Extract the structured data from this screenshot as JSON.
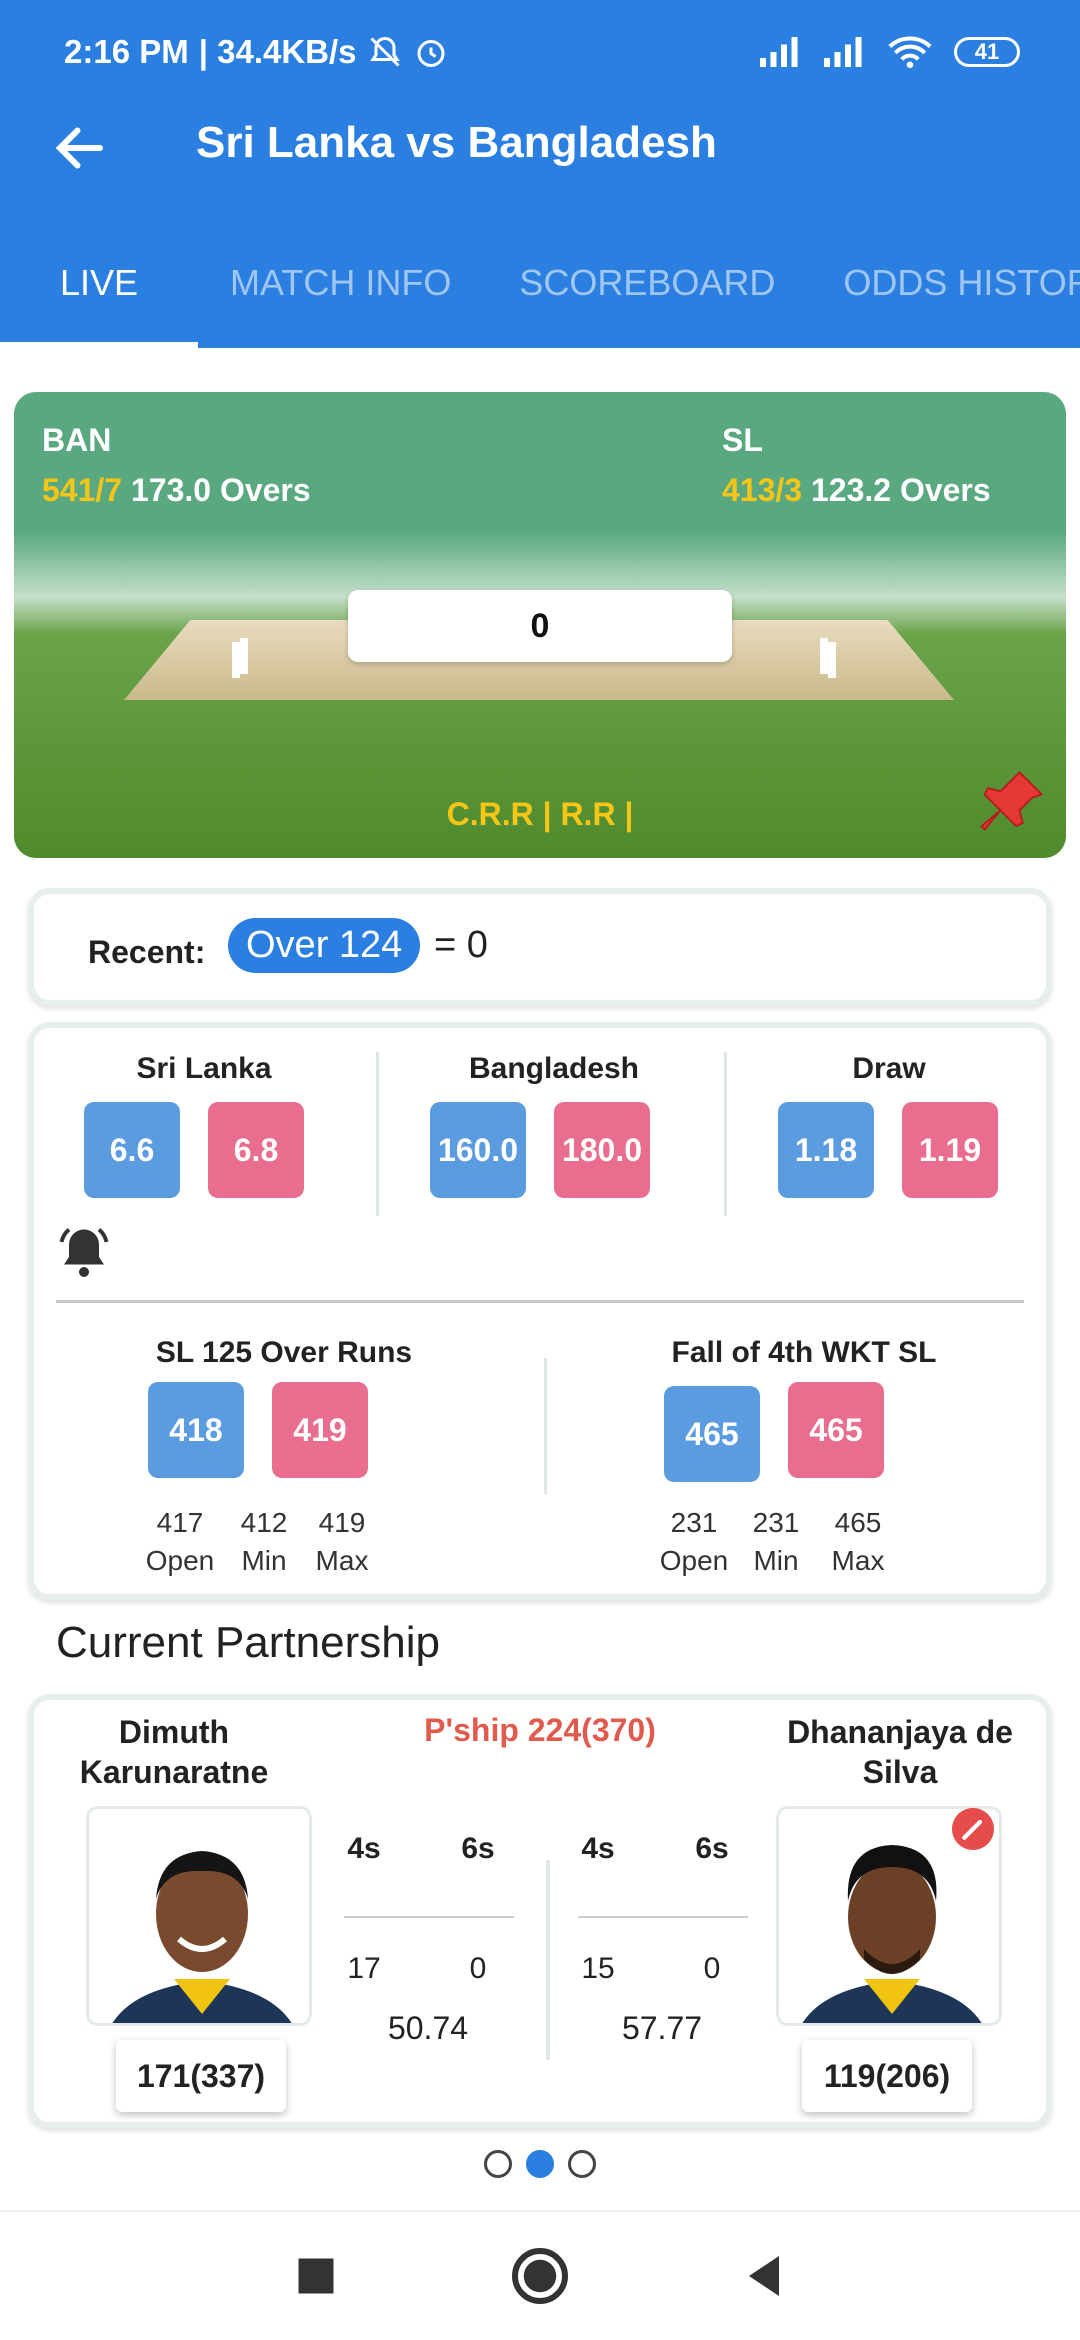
{
  "status_bar": {
    "time": "2:16 PM",
    "speed": "| 34.4KB/s",
    "battery": "41"
  },
  "header": {
    "title": "Sri Lanka vs Bangladesh"
  },
  "tabs": [
    {
      "label": "LIVE"
    },
    {
      "label": "MATCH INFO"
    },
    {
      "label": "SCOREBOARD"
    },
    {
      "label": "ODDS HISTORY"
    }
  ],
  "scorecard": {
    "team1": {
      "name": "BAN",
      "runs": "541/7",
      "overs": "173.0 Overs"
    },
    "team2": {
      "name": "SL",
      "runs": "413/3",
      "overs": "123.2 Overs"
    },
    "ball_value": "0",
    "rates": "C.R.R | R.R |"
  },
  "recent": {
    "label": "Recent:",
    "over": "Over 124",
    "result": "= 0"
  },
  "odds": {
    "match": [
      {
        "name": "Sri Lanka",
        "back": "6.6",
        "lay": "6.8"
      },
      {
        "name": "Bangladesh",
        "back": "160.0",
        "lay": "180.0"
      },
      {
        "name": "Draw",
        "back": "1.18",
        "lay": "1.19"
      }
    ],
    "sessions": [
      {
        "name": "SL 125 Over Runs",
        "back": "418",
        "lay": "419",
        "open": "417",
        "min": "412",
        "max": "419"
      },
      {
        "name": "Fall of 4th WKT SL",
        "back": "465",
        "lay": "465",
        "open": "231",
        "min": "231",
        "max": "465"
      }
    ],
    "labels": {
      "open": "Open",
      "min": "Min",
      "max": "Max"
    }
  },
  "partnership": {
    "title": "Current Partnership",
    "summary": "P'ship 224(370)",
    "headers": {
      "fours": "4s",
      "sixes": "6s"
    },
    "batter1": {
      "name_line1": "Dimuth",
      "name_line2": "Karunaratne",
      "score": "171(337)",
      "fours": "17",
      "sixes": "0",
      "strike_rate": "50.74"
    },
    "batter2": {
      "name_line1": "Dhananjaya de",
      "name_line2": "Silva",
      "score": "119(206)",
      "fours": "15",
      "sixes": "0",
      "strike_rate": "57.77"
    }
  },
  "colors": {
    "primary": "#2a7fe0",
    "back": "#5b9be0",
    "lay": "#e86d8f",
    "highlight": "#f5c518"
  }
}
